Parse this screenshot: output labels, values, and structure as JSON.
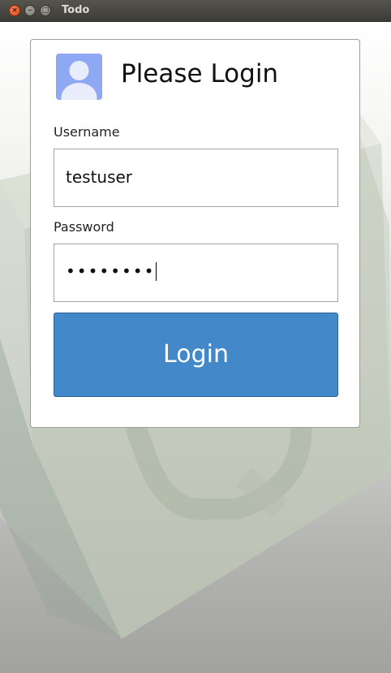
{
  "window": {
    "title": "Todo",
    "close_glyph": "×",
    "minimize_glyph": "–",
    "maximize_glyph": "□"
  },
  "login": {
    "heading": "Please Login",
    "avatar_icon": "user-icon",
    "username_label": "Username",
    "username_value": "testuser",
    "password_label": "Password",
    "password_value": "••••••••",
    "login_button": "Login"
  },
  "colors": {
    "accent": "#4388c9",
    "avatar": "#8fa8f3",
    "titlebar": "#3c3b37"
  }
}
